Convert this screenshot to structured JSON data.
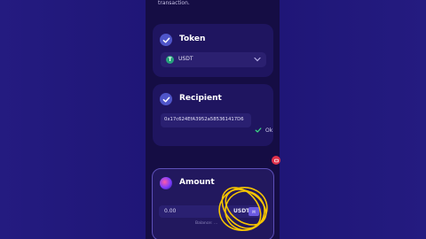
{
  "header": {
    "text": "transaction."
  },
  "token_card": {
    "title": "Token",
    "selected_token": "USDT",
    "token_icon_letter": "T",
    "icon": "checkmark-icon"
  },
  "recipient_card": {
    "title": "Recipient",
    "address": "0x17c624EfA3952a585361417D6",
    "status": "Ok",
    "icon": "checkmark-icon"
  },
  "amount_card": {
    "title": "Amount",
    "value": "0.00",
    "unit": "USDT",
    "max_label": "M",
    "hint": "Balance: ..."
  },
  "colors": {
    "background": "#1e1772",
    "card": "#1f1560",
    "accent": "#4f55c9",
    "ok_green": "#3ddc84",
    "annotation": "#f7c500"
  }
}
